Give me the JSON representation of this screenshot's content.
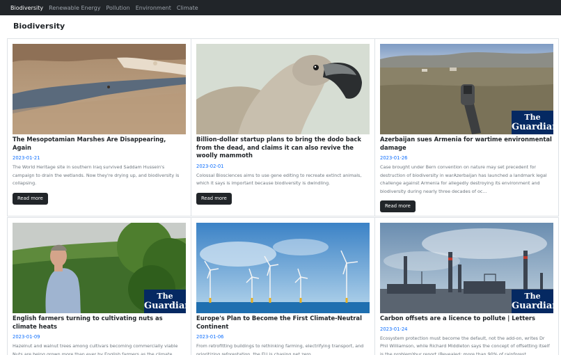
{
  "nav": {
    "items": [
      {
        "label": "Biodiversity",
        "active": true
      },
      {
        "label": "Renewable Energy",
        "active": false
      },
      {
        "label": "Pollution",
        "active": false
      },
      {
        "label": "Environment",
        "active": false
      },
      {
        "label": "Climate",
        "active": false
      }
    ]
  },
  "page": {
    "title": "Biodiversity"
  },
  "logo": {
    "line1": "The",
    "line2": "Guardian"
  },
  "colors": {
    "navbar": "#212529",
    "date": "#0d6efd",
    "button": "#212529",
    "guardian_blue": "#052962"
  },
  "articles": [
    {
      "title": "The Mesopotamian Marshes Are Disappearing, Again",
      "date": "2023-01-21",
      "summary": "The World Heritage site in southern Iraq survived Saddam Hussein's campaign to drain the wetlands. Now they're drying up, and biodiversity is collapsing.",
      "button": "Read more"
    },
    {
      "title": "Billion-dollar startup plans to bring the dodo back from the dead, and claims it can also revive the woolly mammoth",
      "date": "2023-02-01",
      "summary": "Colossal Biosciences aims to use gene editing to recreate extinct animals, which it says is important because biodiversity is dwindling.",
      "button": "Read more"
    },
    {
      "title": "Azerbaijan sues Armenia for wartime environmental damage",
      "date": "2023-01-26",
      "summary": "Case brought under Bern convention on nature may set precedent for destruction of biodiversity in warAzerbaijan has launched a landmark legal challenge against Armenia for allegedly destroying its environment and biodiversity during nearly three decades of oc...",
      "button": "Read more"
    },
    {
      "title": "English farmers turning to cultivating nuts as climate heats",
      "date": "2023-01-09",
      "summary": "Hazelnut and walnut trees among cultivars becoming commercially viable Nuts are being grown more than ever by English farmers as the climate"
    },
    {
      "title": "Europe's Plan to Become the First Climate-Neutral Continent",
      "date": "2023-01-06",
      "summary": "From retrofitting buildings to rethinking farming, electrifying transport, and prioritizing reforestation, the EU is chasing net zero."
    },
    {
      "title": "Carbon offsets are a licence to pollute | Letters",
      "date": "2023-01-24",
      "summary": "Ecosystem protection must become the default, not the add-on, writes Dr Phil Williamson, while Richard Middleton says the concept of offsetting itself is the problemYour report (Revealed: more than 90% of rainforest"
    }
  ]
}
